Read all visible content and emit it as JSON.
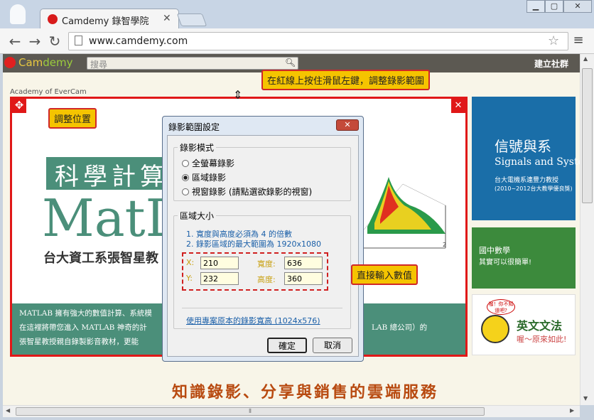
{
  "browser": {
    "tab_title": "Camdemy 錄智學院",
    "url": "www.camdemy.com"
  },
  "site": {
    "logo_cam": "Cam",
    "logo_demy": "demy",
    "search_placeholder": "搜尋",
    "community_label": "建立社群",
    "academy_label": "Academy of EverCam"
  },
  "banner": {
    "title": "科學計算",
    "big_text": "MatL",
    "subtitle": "台大資工系張智星教",
    "desc_line1": "MATLAB 擁有強大的數值計算、系統模",
    "desc_line2": "在這裡將帶您進入 MATLAB 神奇的計",
    "desc_line3": "張智星教授親自錄製影音教材，更能",
    "desc_right": "LAB 總公司）的",
    "plot_tick": "2"
  },
  "sidebar": {
    "card1_title": "信號與系",
    "card1_en": "Signals and Syste",
    "card1_sub1": "台大電機系連豐力教授",
    "card1_sub2": "(2010~2012台大教學優良獎)",
    "card2_title": "國中數學",
    "card2_sub": "其實可以很簡單!",
    "card3_bubble": "咖！你不知道吧?",
    "card3_title": "英文文法",
    "card3_sub": "喔～原來如此!"
  },
  "slogan": "知識錄影、分享與銷售的雲端服務",
  "callouts": {
    "top": "在紅線上按住滑鼠左鍵，調整錄影範圍",
    "move": "調整位置",
    "input": "直接輸入數值"
  },
  "dialog": {
    "title": "錄影範圍設定",
    "mode_group": "錄影模式",
    "radio_full": "全螢幕錄影",
    "radio_region": "區域錄影",
    "radio_window": "視窗錄影 (請點選欲錄影的視窗)",
    "size_group": "區域大小",
    "info1": "1. 寬度與高度必須為 4 的倍數",
    "info2": "2. 錄影區域的最大範圍為 1920x1080",
    "x_label": "X:",
    "y_label": "Y:",
    "width_label": "寬度:",
    "height_label": "高度:",
    "x_value": "210",
    "y_value": "232",
    "width_value": "636",
    "height_value": "360",
    "link": "使用專案原本的錄影寬高 (1024x576)",
    "ok": "確定",
    "cancel": "取消"
  }
}
